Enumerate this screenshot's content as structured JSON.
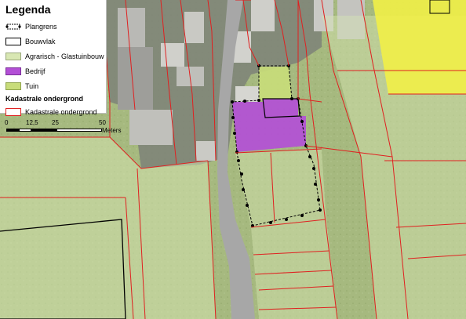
{
  "legend": {
    "title": "Legenda",
    "items": [
      {
        "label": "Plangrens",
        "type": "plangrens",
        "color": "#000000"
      },
      {
        "label": "Bouwvlak",
        "type": "outline",
        "color": "#000000"
      },
      {
        "label": "Agrarisch - Glastuinbouw",
        "type": "fill",
        "color": "#d8e7b3"
      },
      {
        "label": "Bedrijf",
        "type": "fill",
        "color": "#b34fd6"
      },
      {
        "label": "Tuin",
        "type": "fill",
        "color": "#c8dc7a"
      }
    ],
    "cadastral_title": "Kadastrale ondergrond",
    "cadastral_item": {
      "label": "Kadastrale ondergrond",
      "color": "#e02020"
    }
  },
  "scalebar": {
    "labels": [
      "0",
      "12,5",
      "25",
      "50"
    ],
    "unit": "Meters"
  },
  "map_colors": {
    "agrarisch": "#d8e7b3",
    "bedrijf": "#b34fd6",
    "tuin": "#c8dc7a",
    "yellow_zone": "#f3f046",
    "parcel_lines": "#e02020",
    "road": "#a7a7a7",
    "built_area": "#8b8f86"
  }
}
